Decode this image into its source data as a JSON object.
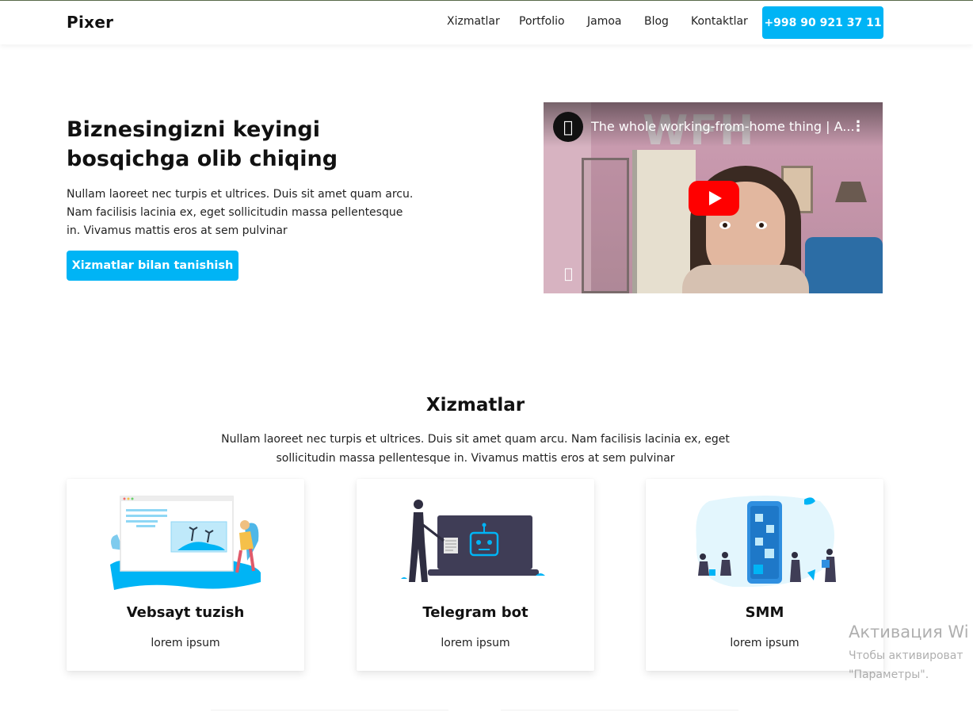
{
  "header": {
    "logo": "Pixer",
    "nav": [
      "Xizmatlar",
      "Portfolio",
      "Jamoa",
      "Blog",
      "Kontaktlar"
    ],
    "phone": "+998 90 921 37 11"
  },
  "hero": {
    "title": "Biznesingizni keyingi bosqichga olib chiqing",
    "text": "Nullam laoreet nec turpis et ultrices. Duis sit amet quam arcu. Nam facilisis lacinia ex, eget sollicitudin massa pellentesque in. Vivamus mattis eros at sem pulvinar",
    "button": "Xizmatlar bilan tanishish"
  },
  "video": {
    "title": "The whole working-from-home thing | A...",
    "overlay_text": "WFH",
    "channel_icon": "apple-logo-icon",
    "play_icon": "youtube-play-icon"
  },
  "services": {
    "title": "Xizmatlar",
    "text": "Nullam laoreet nec turpis et ultrices. Duis sit amet quam arcu. Nam facilisis lacinia ex, eget sollicitudin massa pellentesque in. Vivamus mattis eros at sem pulvinar",
    "cards": [
      {
        "title": "Vebsayt tuzish",
        "subtitle": "lorem ipsum",
        "icon": "website-illustration"
      },
      {
        "title": "Telegram bot",
        "subtitle": "lorem ipsum",
        "icon": "bot-illustration"
      },
      {
        "title": "SMM",
        "subtitle": "lorem ipsum",
        "icon": "social-media-illustration"
      }
    ]
  },
  "watermark": {
    "line1": "Активация Wi",
    "line2": "Чтобы активироват",
    "line3": "\"Параметры\"."
  },
  "colors": {
    "accent": "#00b4f5",
    "text": "#111111",
    "youtube_red": "#ff0000"
  }
}
